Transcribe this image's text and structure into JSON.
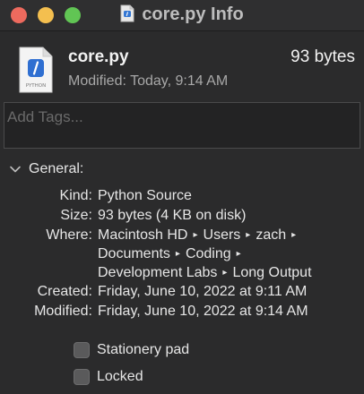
{
  "window": {
    "title": "core.py Info",
    "traffic_lights": {
      "close": "#ed6a5e",
      "minimize": "#f4bf4f",
      "zoom": "#61c554"
    }
  },
  "file": {
    "name": "core.py",
    "size": "93 bytes",
    "modified": "Modified: Today, 9:14 AM",
    "icon": "python-file-icon",
    "icon_caption": "PYTHON"
  },
  "tags": {
    "placeholder": "Add Tags..."
  },
  "general": {
    "header": "General:",
    "kind_label": "Kind:",
    "kind_value": "Python Source",
    "size_label": "Size:",
    "size_value": "93 bytes (4 KB on disk)",
    "where_label": "Where:",
    "where_path": [
      "Macintosh HD",
      "Users",
      "zach",
      "Documents",
      "Coding",
      "Development Labs",
      "Long Output"
    ],
    "created_label": "Created:",
    "created_value": "Friday, June 10, 2022 at 9:11 AM",
    "modified_label": "Modified:",
    "modified_value": "Friday, June 10, 2022 at 9:14 AM"
  },
  "checkboxes": {
    "stationery_pad": {
      "label": "Stationery pad",
      "checked": false
    },
    "locked": {
      "label": "Locked",
      "checked": false
    }
  }
}
